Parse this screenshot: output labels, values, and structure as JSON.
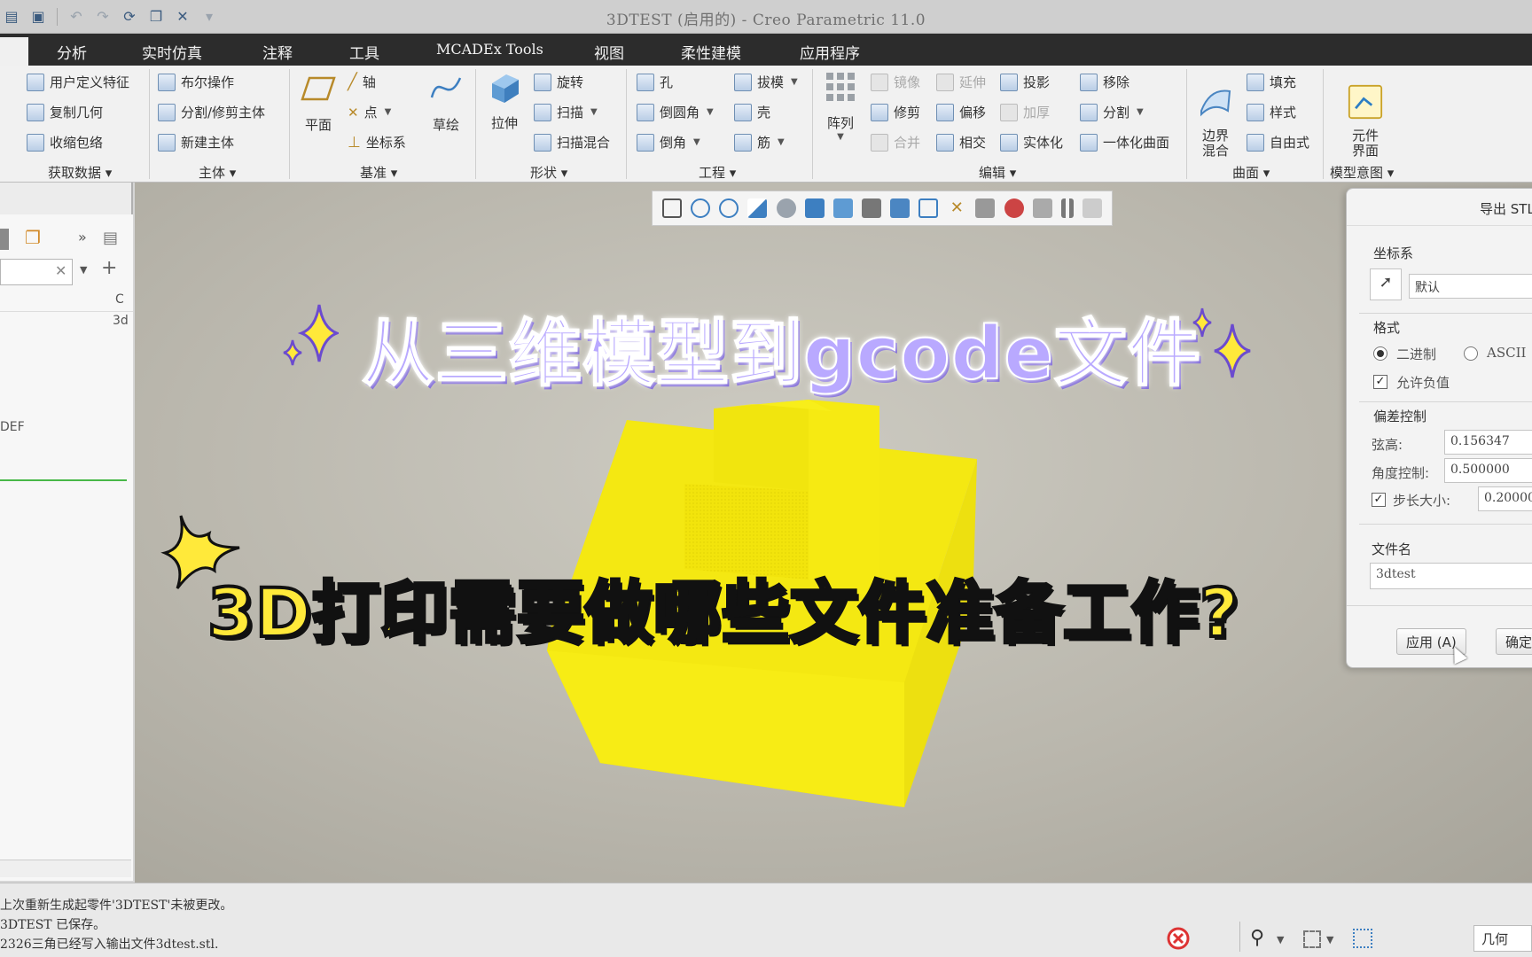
{
  "window": {
    "title": "3DTEST (启用的) - Creo Parametric 11.0"
  },
  "ribbon": {
    "tabs": [
      "分析",
      "实时仿真",
      "注释",
      "工具",
      "MCADEx Tools",
      "视图",
      "柔性建模",
      "应用程序"
    ],
    "groups": {
      "get_data": {
        "label": "获取数据",
        "items": [
          "用户定义特征",
          "复制几何",
          "收缩包络"
        ]
      },
      "body": {
        "label": "主体",
        "items": [
          "布尔操作",
          "分割/修剪主体",
          "新建主体"
        ]
      },
      "datum": {
        "label": "基准",
        "plane": "平面",
        "axis": "轴",
        "point": "点",
        "csys": "坐标系",
        "sketch": "草绘"
      },
      "shapes": {
        "label": "形状",
        "extrude": "拉伸",
        "items": [
          "旋转",
          "扫描",
          "扫描混合"
        ]
      },
      "engineering": {
        "label": "工程",
        "items": [
          "孔",
          "倒圆角",
          "倒角",
          "拔模",
          "壳",
          "筋"
        ]
      },
      "editing": {
        "label": "编辑",
        "pattern": "阵列",
        "items": [
          "镜像",
          "延伸",
          "投影",
          "移除",
          "修剪",
          "偏移",
          "加厚",
          "分割",
          "合并",
          "相交",
          "实体化",
          "一体化曲面"
        ]
      },
      "surfaces": {
        "label": "曲面",
        "boundary": "边界\n混合",
        "items": [
          "填充",
          "样式",
          "自由式"
        ]
      },
      "model_intent": {
        "label": "模型意图",
        "component": "元件\n界面"
      }
    }
  },
  "model_tree": {
    "column_header": "C",
    "row_3d": "3d",
    "row_def": "DEF"
  },
  "overlay": {
    "headline": "从三维模型到gcode文件",
    "subline": "3D打印需要做哪些文件准备工作?"
  },
  "export_dialog": {
    "title": "导出 STL",
    "csys_label": "坐标系",
    "csys_value": "默认",
    "format_label": "格式",
    "format_binary": "二进制",
    "format_ascii": "ASCII",
    "allow_negative": "允许负值",
    "deviation_label": "偏差控制",
    "chord_height_label": "弦高:",
    "chord_height_value": "0.156347",
    "angle_control_label": "角度控制:",
    "angle_control_value": "0.500000",
    "step_size_label": "步长大小:",
    "step_size_value": "0.20000",
    "filename_label": "文件名",
    "filename_value": "3dtest",
    "apply_button": "应用 (A)",
    "ok_button": "确定"
  },
  "status": {
    "messages": [
      "上次重新生成起零件'3DTEST'未被更改。",
      "3DTEST 已保存。",
      "2326三角已经写入输出文件3dtest.stl."
    ],
    "filter_value": "几何"
  },
  "colors": {
    "model_yellow": "#f5ea12",
    "tabbar": "#2c2c2c",
    "headline_purple": "#b9a9ff",
    "subline_yellow": "#ffe93a"
  }
}
